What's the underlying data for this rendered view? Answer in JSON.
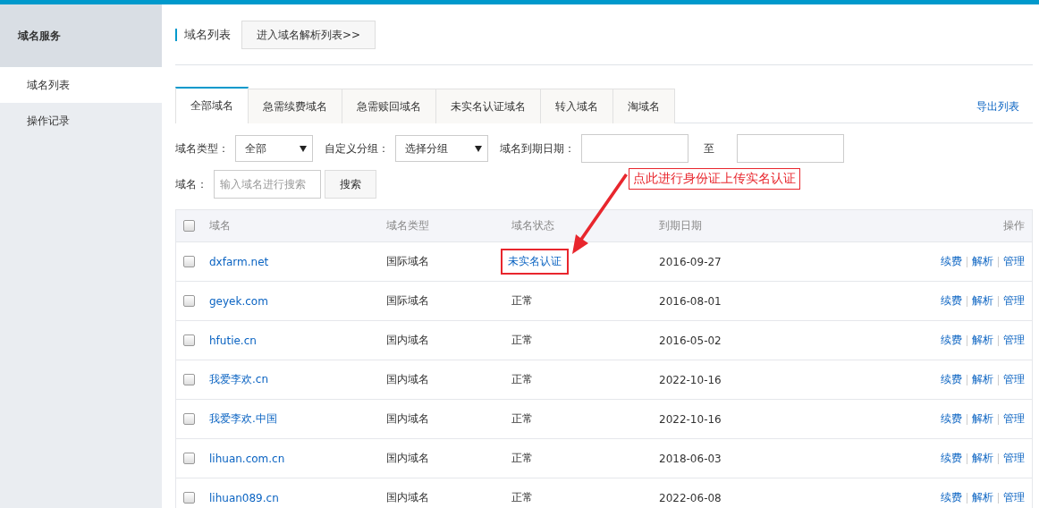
{
  "sidebar": {
    "title": "域名服务",
    "items": [
      {
        "label": "域名列表",
        "selected": true
      },
      {
        "label": "操作记录",
        "selected": false
      }
    ]
  },
  "header": {
    "title": "域名列表",
    "button": "进入域名解析列表>>"
  },
  "tabs": [
    {
      "label": "全部域名",
      "selected": true
    },
    {
      "label": "急需续费域名",
      "selected": false
    },
    {
      "label": "急需赎回域名",
      "selected": false
    },
    {
      "label": "未实名认证域名",
      "selected": false
    },
    {
      "label": "转入域名",
      "selected": false
    },
    {
      "label": "淘域名",
      "selected": false
    }
  ],
  "export_link": "导出列表",
  "filters": {
    "type_label": "域名类型：",
    "type_value": "全部",
    "group_label": "自定义分组：",
    "group_value": "选择分组",
    "date_label": "域名到期日期：",
    "date_sep": "至",
    "name_label": "域名：",
    "name_placeholder": "输入域名进行搜索",
    "search_button": "搜索"
  },
  "annotation": "点此进行身份证上传实名认证",
  "table": {
    "columns": [
      "域名",
      "域名类型",
      "域名状态",
      "到期日期",
      "操作"
    ],
    "select_all_checked": false,
    "rows": [
      {
        "name": "dxfarm.net",
        "type": "国际域名",
        "status": "未实名认证",
        "alert": true,
        "date": "2016-09-27",
        "checked": false,
        "actions": [
          "续费",
          "解析",
          "管理"
        ]
      },
      {
        "name": "geyek.com",
        "type": "国际域名",
        "status": "正常",
        "alert": false,
        "date": "2016-08-01",
        "checked": false,
        "actions": [
          "续费",
          "解析",
          "管理"
        ]
      },
      {
        "name": "hfutie.cn",
        "type": "国内域名",
        "status": "正常",
        "alert": false,
        "date": "2016-05-02",
        "checked": false,
        "actions": [
          "续费",
          "解析",
          "管理"
        ]
      },
      {
        "name": "我爱李欢.cn",
        "type": "国内域名",
        "status": "正常",
        "alert": false,
        "date": "2022-10-16",
        "checked": false,
        "actions": [
          "续费",
          "解析",
          "管理"
        ]
      },
      {
        "name": "我爱李欢.中国",
        "type": "国内域名",
        "status": "正常",
        "alert": false,
        "date": "2022-10-16",
        "checked": false,
        "actions": [
          "续费",
          "解析",
          "管理"
        ]
      },
      {
        "name": "lihuan.com.cn",
        "type": "国内域名",
        "status": "正常",
        "alert": false,
        "date": "2018-06-03",
        "checked": false,
        "actions": [
          "续费",
          "解析",
          "管理"
        ]
      },
      {
        "name": "lihuan089.cn",
        "type": "国内域名",
        "status": "正常",
        "alert": false,
        "date": "2022-06-08",
        "checked": false,
        "actions": [
          "续费",
          "解析",
          "管理"
        ]
      }
    ]
  }
}
